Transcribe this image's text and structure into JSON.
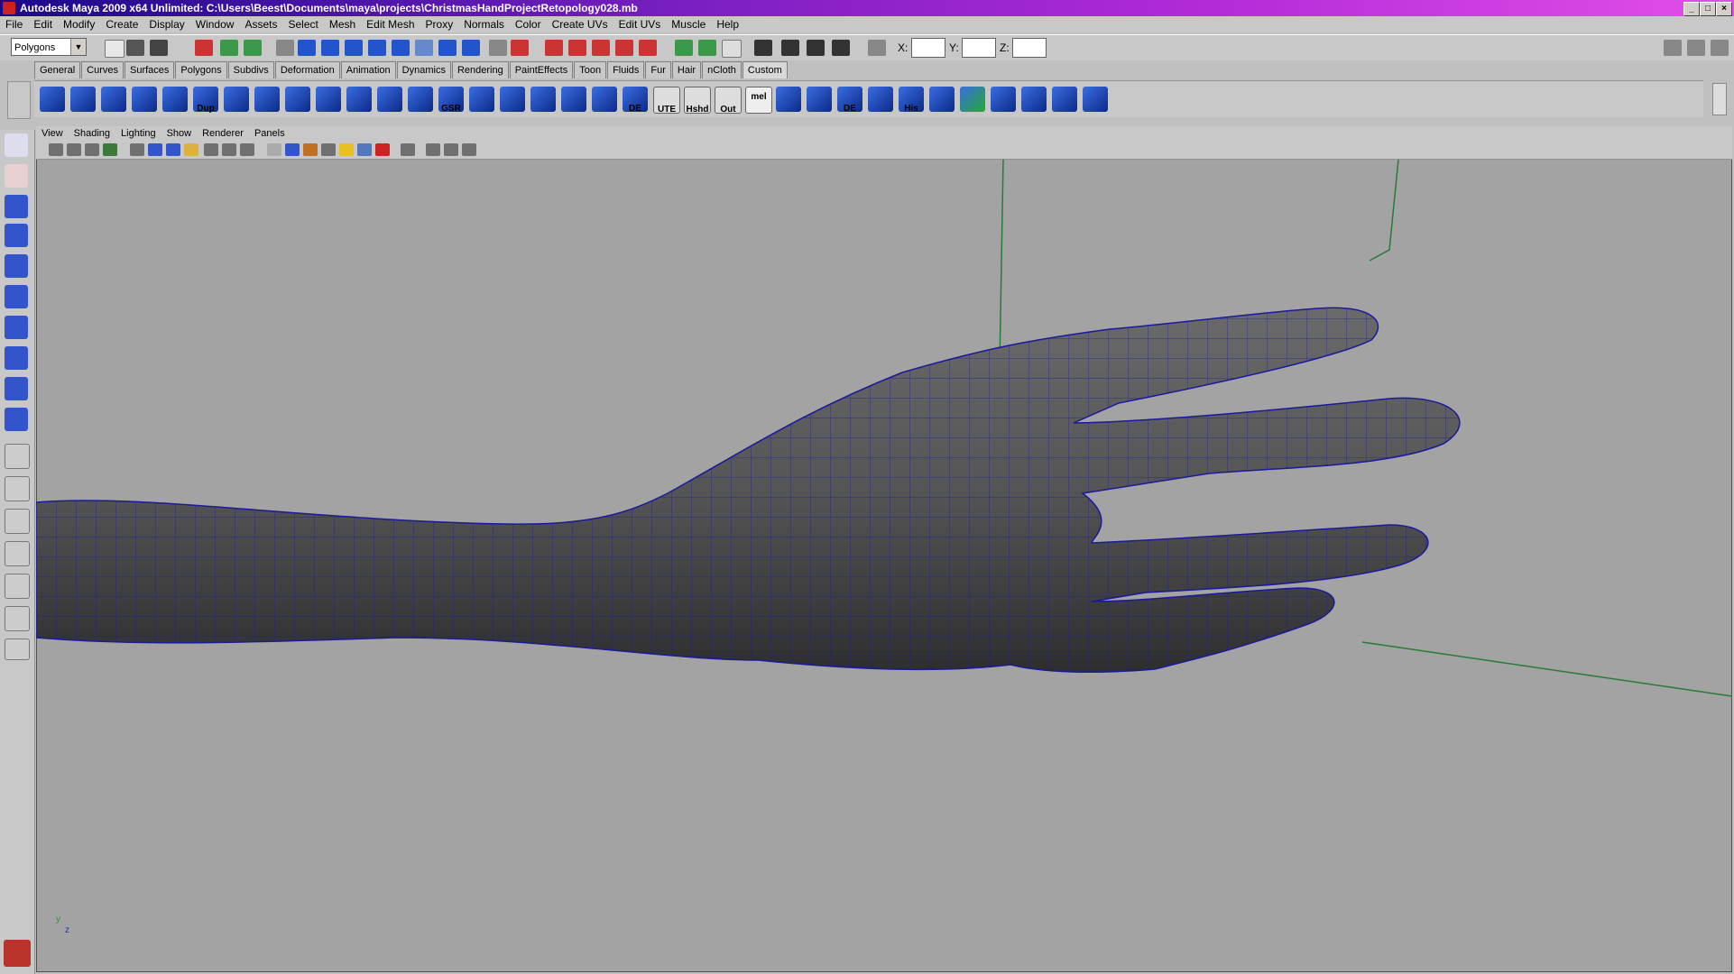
{
  "titlebar": {
    "title": "Autodesk Maya 2009 x64 Unlimited: C:\\Users\\Beest\\Documents\\maya\\projects\\ChristmasHandProjectRetopology028.mb",
    "min": "_",
    "max": "□",
    "close": "×"
  },
  "menubar": [
    "File",
    "Edit",
    "Modify",
    "Create",
    "Display",
    "Window",
    "Assets",
    "Select",
    "Mesh",
    "Edit Mesh",
    "Proxy",
    "Normals",
    "Color",
    "Create UVs",
    "Edit UVs",
    "Muscle",
    "Help"
  ],
  "statusline": {
    "menuset": "Polygons",
    "x_label": "X:",
    "y_label": "Y:",
    "z_label": "Z:"
  },
  "shelf_tabs": [
    "General",
    "Curves",
    "Surfaces",
    "Polygons",
    "Subdivs",
    "Deformation",
    "Animation",
    "Dynamics",
    "Rendering",
    "PaintEffects",
    "Toon",
    "Fluids",
    "Fur",
    "Hair",
    "nCloth",
    "Custom"
  ],
  "active_shelf_tab": "Custom",
  "shelf_labels": {
    "dup": "Dup",
    "gsr": "GSR",
    "de1": "DE",
    "ute": "UTE",
    "hshd": "Hshd",
    "out": "Out",
    "mel": "mel",
    "de2": "DE",
    "his": "His"
  },
  "panel_menu": [
    "View",
    "Shading",
    "Lighting",
    "Show",
    "Renderer",
    "Panels"
  ],
  "axis": {
    "y": "y",
    "z": "z"
  },
  "colors": {
    "viewport_bg": "#a3a3a3",
    "wire": "#1a1a9a",
    "grid_line": "#2a7a3a",
    "mesh": "#555555"
  }
}
